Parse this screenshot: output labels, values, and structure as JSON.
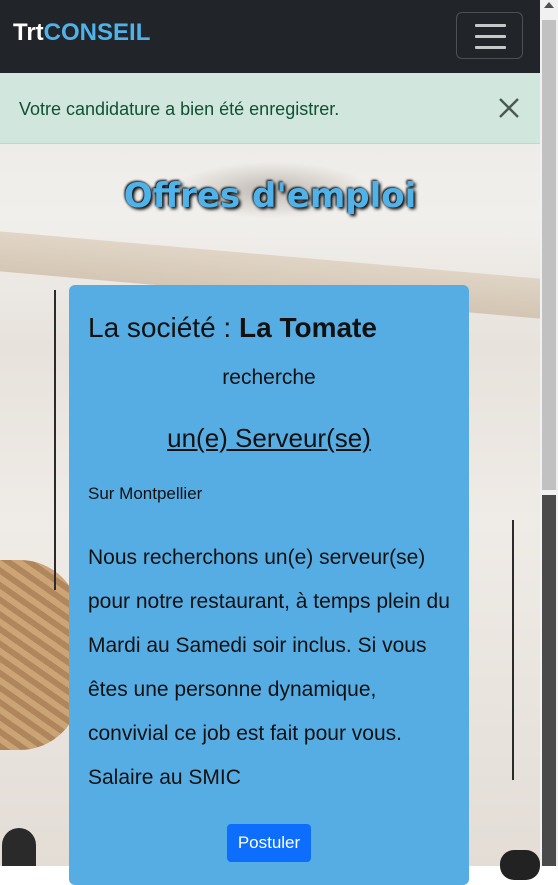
{
  "navbar": {
    "brand_prefix": "Trt",
    "brand_suffix": "CONSEIL",
    "menu_icon": "hamburger-menu-icon"
  },
  "alert": {
    "message": "Votre candidature a bien été enregistrer.",
    "close_icon": "close-icon"
  },
  "page": {
    "title": "Offres d'emploi"
  },
  "offer": {
    "company_prefix": "La société : ",
    "company_name": "La Tomate",
    "looking_for": "recherche",
    "job_title": "un(e) Serveur(se)",
    "location": "Sur Montpellier",
    "description": "Nous recherchons un(e) serveur(se) pour notre restaurant, à temps plein du Mardi au Samedi soir inclus. Si vous êtes une personne dynamique, convivial ce job est fait pour vous. Salaire au SMIC",
    "apply_label": "Postuler"
  },
  "colors": {
    "navbar_bg": "#212529",
    "brand_accent": "#4fb3ea",
    "alert_bg": "#d1e7dd",
    "card_bg": "#56ade3",
    "button_bg": "#0d6efd"
  }
}
